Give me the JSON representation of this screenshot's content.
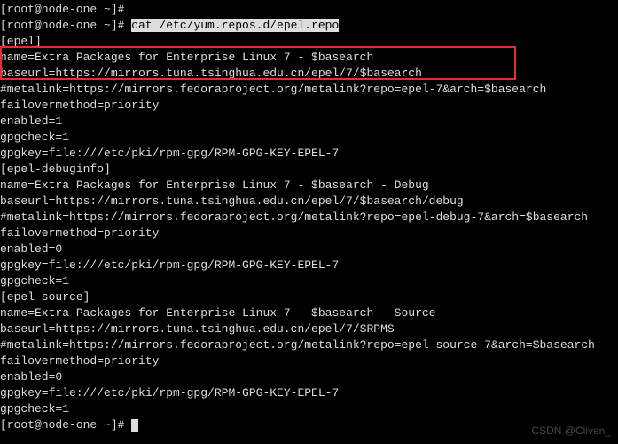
{
  "prompt1": "[root@node-one ~]#",
  "prompt2": "[root@node-one ~]# ",
  "command": "cat /etc/yum.repos.d/epel.repo",
  "prompt3": "[root@node-one ~]# ",
  "lines": {
    "l01": "[epel]",
    "l02": "name=Extra Packages for Enterprise Linux 7 - $basearch",
    "l03": "baseurl=https://mirrors.tuna.tsinghua.edu.cn/epel/7/$basearch",
    "l04": "#metalink=https://mirrors.fedoraproject.org/metalink?repo=epel-7&arch=$basearch",
    "l05": "failovermethod=priority",
    "l06": "enabled=1",
    "l07": "gpgcheck=1",
    "l08": "gpgkey=file:///etc/pki/rpm-gpg/RPM-GPG-KEY-EPEL-7",
    "l09": "",
    "l10": "[epel-debuginfo]",
    "l11": "name=Extra Packages for Enterprise Linux 7 - $basearch - Debug",
    "l12": "baseurl=https://mirrors.tuna.tsinghua.edu.cn/epel/7/$basearch/debug",
    "l13": "#metalink=https://mirrors.fedoraproject.org/metalink?repo=epel-debug-7&arch=$basearch",
    "l14": "failovermethod=priority",
    "l15": "enabled=0",
    "l16": "gpgkey=file:///etc/pki/rpm-gpg/RPM-GPG-KEY-EPEL-7",
    "l17": "gpgcheck=1",
    "l18": "",
    "l19": "[epel-source]",
    "l20": "name=Extra Packages for Enterprise Linux 7 - $basearch - Source",
    "l21": "baseurl=https://mirrors.tuna.tsinghua.edu.cn/epel/7/SRPMS",
    "l22": "#metalink=https://mirrors.fedoraproject.org/metalink?repo=epel-source-7&arch=$basearch",
    "l23": "failovermethod=priority",
    "l24": "enabled=0",
    "l25": "gpgkey=file:///etc/pki/rpm-gpg/RPM-GPG-KEY-EPEL-7",
    "l26": "gpgcheck=1"
  },
  "watermark": "CSDN @Cliven_"
}
